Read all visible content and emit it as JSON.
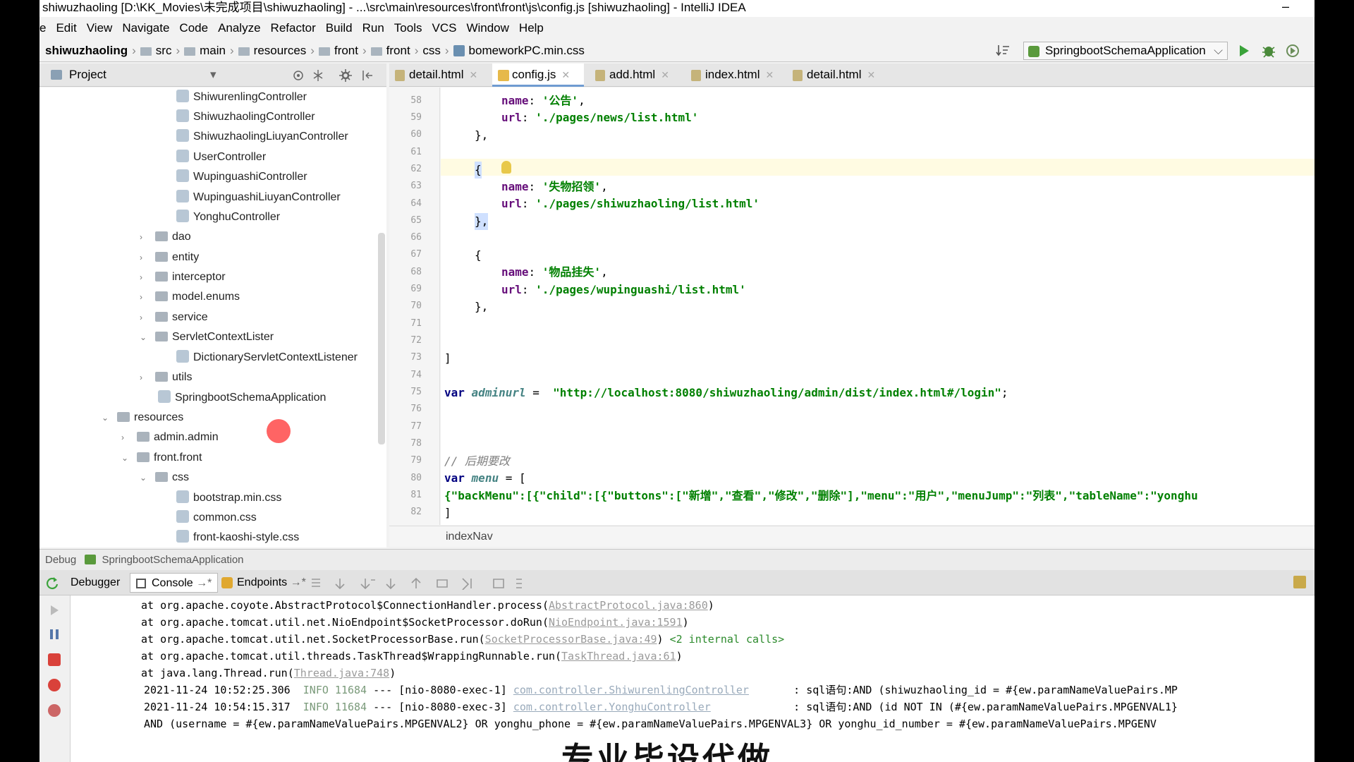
{
  "title": "shiwuzhaoling [D:\\KK_Movies\\未完成项目\\shiwuzhaoling] - ...\\src\\main\\resources\\front\\front\\js\\config.js [shiwuzhaoling] - IntelliJ IDEA",
  "window_min": "–",
  "menu": [
    "e",
    "Edit",
    "View",
    "Navigate",
    "Code",
    "Analyze",
    "Refactor",
    "Build",
    "Run",
    "Tools",
    "VCS",
    "Window",
    "Help"
  ],
  "breadcrumb": [
    "shiwuzhaoling",
    "src",
    "main",
    "resources",
    "front",
    "front",
    "css",
    "bomeworkPC.min.css"
  ],
  "run_config": "SpringbootSchemaApplication",
  "project_panel": {
    "title": "Project"
  },
  "tabs": [
    {
      "label": "detail.html"
    },
    {
      "label": "config.js"
    },
    {
      "label": "add.html"
    },
    {
      "label": "index.html"
    },
    {
      "label": "detail.html"
    }
  ],
  "tree": [
    {
      "label": "ShiwurenlingController",
      "kind": "class"
    },
    {
      "label": "ShiwuzhaolingController",
      "kind": "class"
    },
    {
      "label": "ShiwuzhaolingLiuyanController",
      "kind": "class"
    },
    {
      "label": "UserController",
      "kind": "class"
    },
    {
      "label": "WupinguashiController",
      "kind": "class"
    },
    {
      "label": "WupinguashiLiuyanController",
      "kind": "class"
    },
    {
      "label": "YonghuController",
      "kind": "class"
    },
    {
      "label": "dao",
      "kind": "folder"
    },
    {
      "label": "entity",
      "kind": "folder"
    },
    {
      "label": "interceptor",
      "kind": "folder"
    },
    {
      "label": "model.enums",
      "kind": "folder"
    },
    {
      "label": "service",
      "kind": "folder"
    },
    {
      "label": "ServletContextLister",
      "kind": "folder"
    },
    {
      "label": "DictionaryServletContextListener",
      "kind": "class"
    },
    {
      "label": "utils",
      "kind": "folder"
    },
    {
      "label": "SpringbootSchemaApplication",
      "kind": "class"
    },
    {
      "label": "resources",
      "kind": "folder"
    },
    {
      "label": "admin.admin",
      "kind": "folder"
    },
    {
      "label": "front.front",
      "kind": "folder"
    },
    {
      "label": "css",
      "kind": "folder"
    },
    {
      "label": "bootstrap.min.css",
      "kind": "file"
    },
    {
      "label": "common.css",
      "kind": "file"
    },
    {
      "label": "front-kaoshi-style.css",
      "kind": "file"
    }
  ],
  "line_numbers": [
    "58",
    "59",
    "60",
    "61",
    "62",
    "63",
    "64",
    "65",
    "66",
    "67",
    "68",
    "69",
    "70",
    "71",
    "72",
    "73",
    "74",
    "75",
    "76",
    "77",
    "78",
    "79",
    "80",
    "81",
    "82"
  ],
  "code": {
    "l58_key": "name",
    "l58_val": "'公告'",
    "l59_key": "url",
    "l59_val": "'./pages/news/list.html'",
    "close_brace": "},",
    "open_brace": "{",
    "l63_key": "name",
    "l63_val": "'失物招领'",
    "l64_key": "url",
    "l64_val": "'./pages/shiwuzhaoling/list.html'",
    "l68_key": "name",
    "l68_val": "'物品挂失'",
    "l69_key": "url",
    "l69_val": "'./pages/wupinguashi/list.html'",
    "l73": "]",
    "l75_kw": "var",
    "l75_name": "adminurl",
    "l75_eq": " =  ",
    "l75_val": "\"http://localhost:8080/shiwuzhaoling/admin/dist/index.html#/login\"",
    "l75_end": ";",
    "l79": "// 后期要改",
    "l80_kw": "var",
    "l80_name": "menu",
    "l80_rest": " = [",
    "l81": "{\"backMenu\":[{\"child\":[{\"buttons\":[\"新增\",\"查看\",\"修改\",\"删除\"],\"menu\":\"用户\",\"menuJump\":\"列表\",\"tableName\":\"yonghu",
    "l82": "]",
    "colon": ": "
  },
  "editor_nav": "indexNav",
  "debug": {
    "label": "Debug",
    "app": "SpringbootSchemaApplication",
    "tabs": [
      "Debugger",
      "Console",
      "Endpoints"
    ]
  },
  "console": [
    {
      "pre": "at org.apache.coyote.AbstractProtocol$ConnectionHandler.process(",
      "link": "AbstractProtocol.java:860",
      "post": ")"
    },
    {
      "pre": "at org.apache.tomcat.util.net.NioEndpoint$SocketProcessor.doRun(",
      "link": "NioEndpoint.java:1591",
      "post": ")"
    },
    {
      "pre": "at org.apache.tomcat.util.net.SocketProcessorBase.run(",
      "link": "SocketProcessorBase.java:49",
      "post": ") ",
      "extra": "<2 internal calls>"
    },
    {
      "pre": "at org.apache.tomcat.util.threads.TaskThread$WrappingRunnable.run(",
      "link": "TaskThread.java:61",
      "post": ")"
    },
    {
      "pre": "at java.lang.Thread.run(",
      "link": "Thread.java:748",
      "post": ")"
    }
  ],
  "log": [
    {
      "time": "2021-11-24 10:52:25.306 ",
      "level": " INFO 11684 ",
      "mid": "--- [nio-8080-exec-1] ",
      "cls": "com.controller.ShiwurenlingController",
      "msg": "       : sql语句:AND (shiwuzhaoling_id = #{ew.paramNameValuePairs.MP"
    },
    {
      "time": "2021-11-24 10:54:15.317 ",
      "level": " INFO 11684 ",
      "mid": "--- [nio-8080-exec-3] ",
      "cls": "com.controller.YonghuController",
      "msg": "             : sql语句:AND (id NOT IN (#{ew.paramNameValuePairs.MPGENVAL1}"
    }
  ],
  "log_cont": "AND (username = #{ew.paramNameValuePairs.MPGENVAL2} OR yonghu_phone = #{ew.paramNameValuePairs.MPGENVAL3} OR yonghu_id_number = #{ew.paramNameValuePairs.MPGENV",
  "subtitle": "专业毕设代做"
}
